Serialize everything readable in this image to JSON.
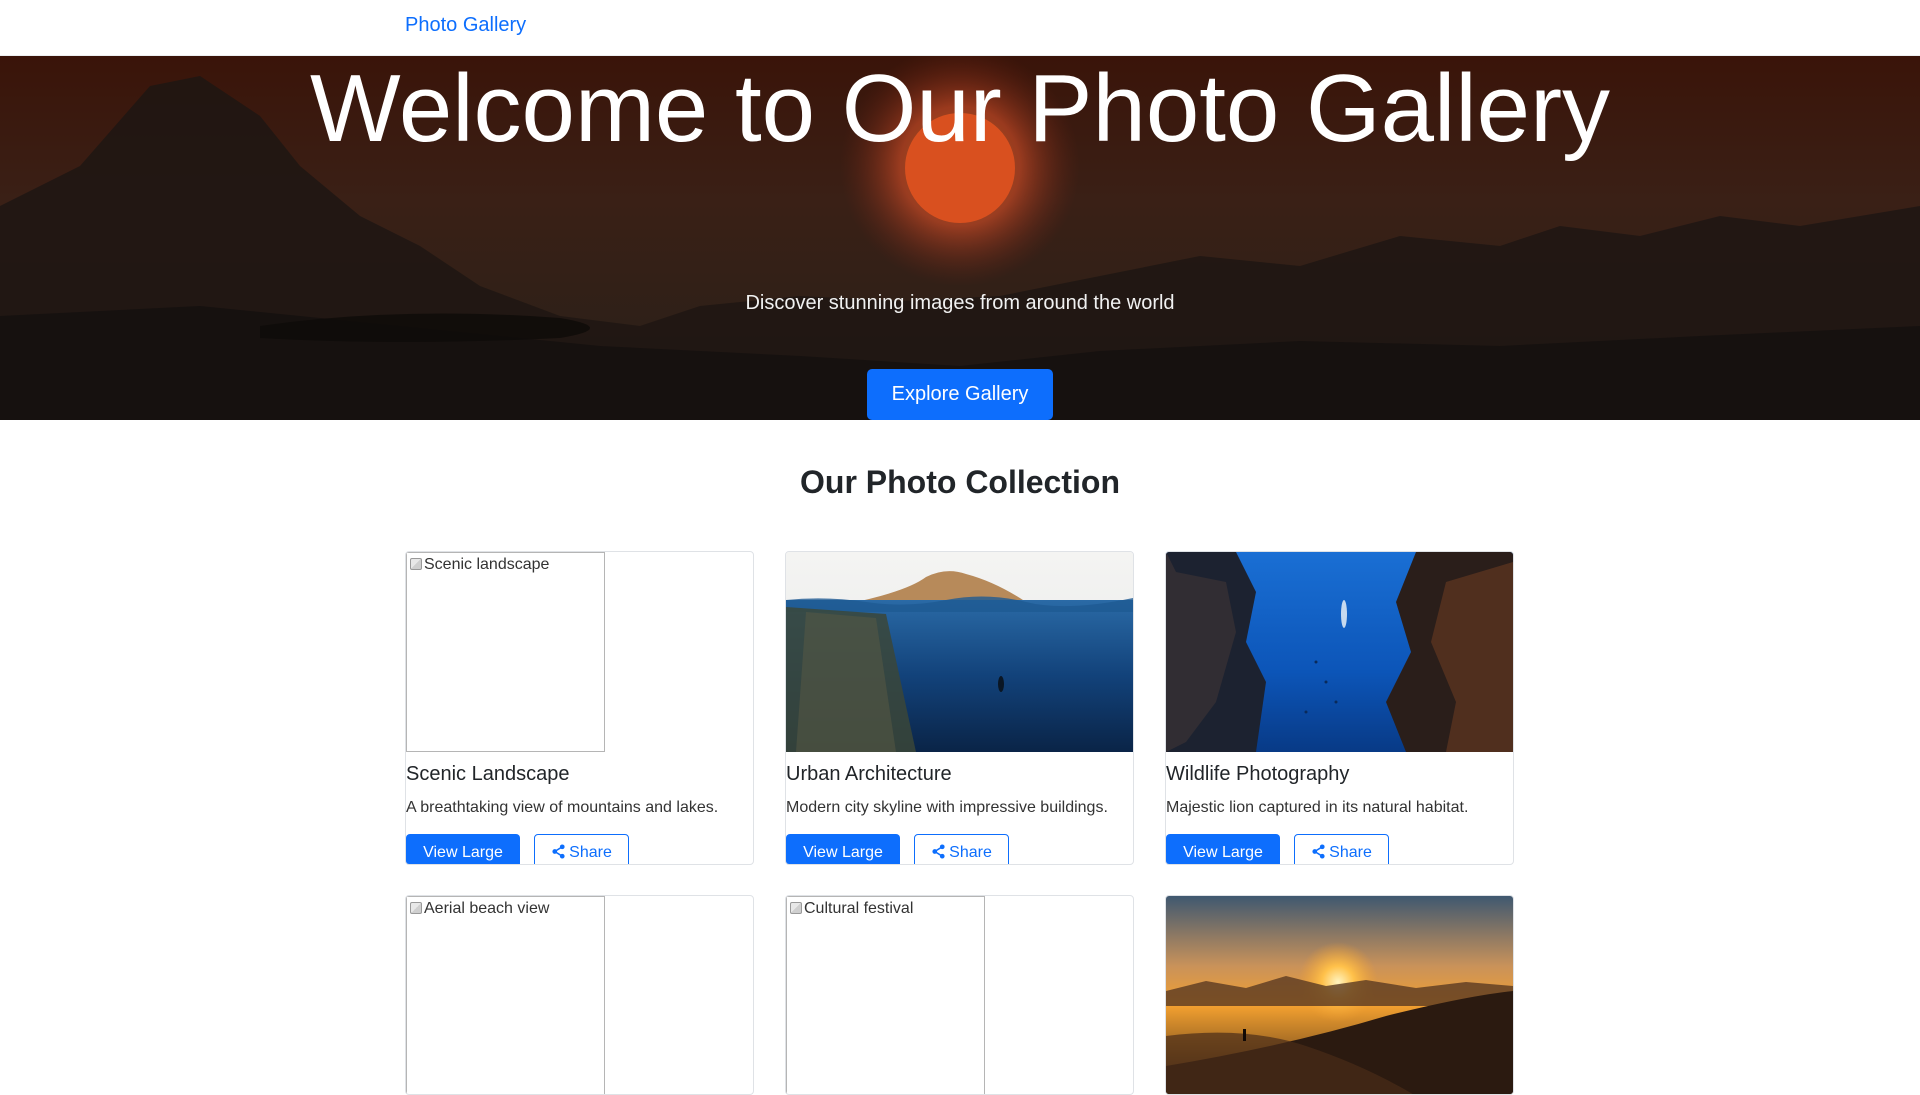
{
  "nav": {
    "brand": "Photo Gallery"
  },
  "hero": {
    "title": "Welcome to Our Photo Gallery",
    "subtitle": "Discover stunning images from around the world",
    "button": "Explore Gallery"
  },
  "section": {
    "title": "Our Photo Collection"
  },
  "cards": [
    {
      "alt": "Scenic landscape",
      "title": "Scenic Landscape",
      "text": "A breathtaking view of mountains and lakes.",
      "view_label": "View Large",
      "share_label": "Share",
      "image": "broken"
    },
    {
      "alt": "Urban architecture",
      "title": "Urban Architecture",
      "text": "Modern city skyline with impressive buildings.",
      "view_label": "View Large",
      "share_label": "Share",
      "image": "ocean-island"
    },
    {
      "alt": "Wildlife photography",
      "title": "Wildlife Photography",
      "text": "Majestic lion captured in its natural habitat.",
      "view_label": "View Large",
      "share_label": "Share",
      "image": "underwater-reef"
    },
    {
      "alt": "Aerial beach view",
      "image": "broken"
    },
    {
      "alt": "Cultural festival",
      "image": "broken"
    },
    {
      "alt": "Sunset",
      "image": "desert-sunset"
    }
  ],
  "colors": {
    "primary": "#0d6efd",
    "hero_dark": "#2e1810"
  }
}
